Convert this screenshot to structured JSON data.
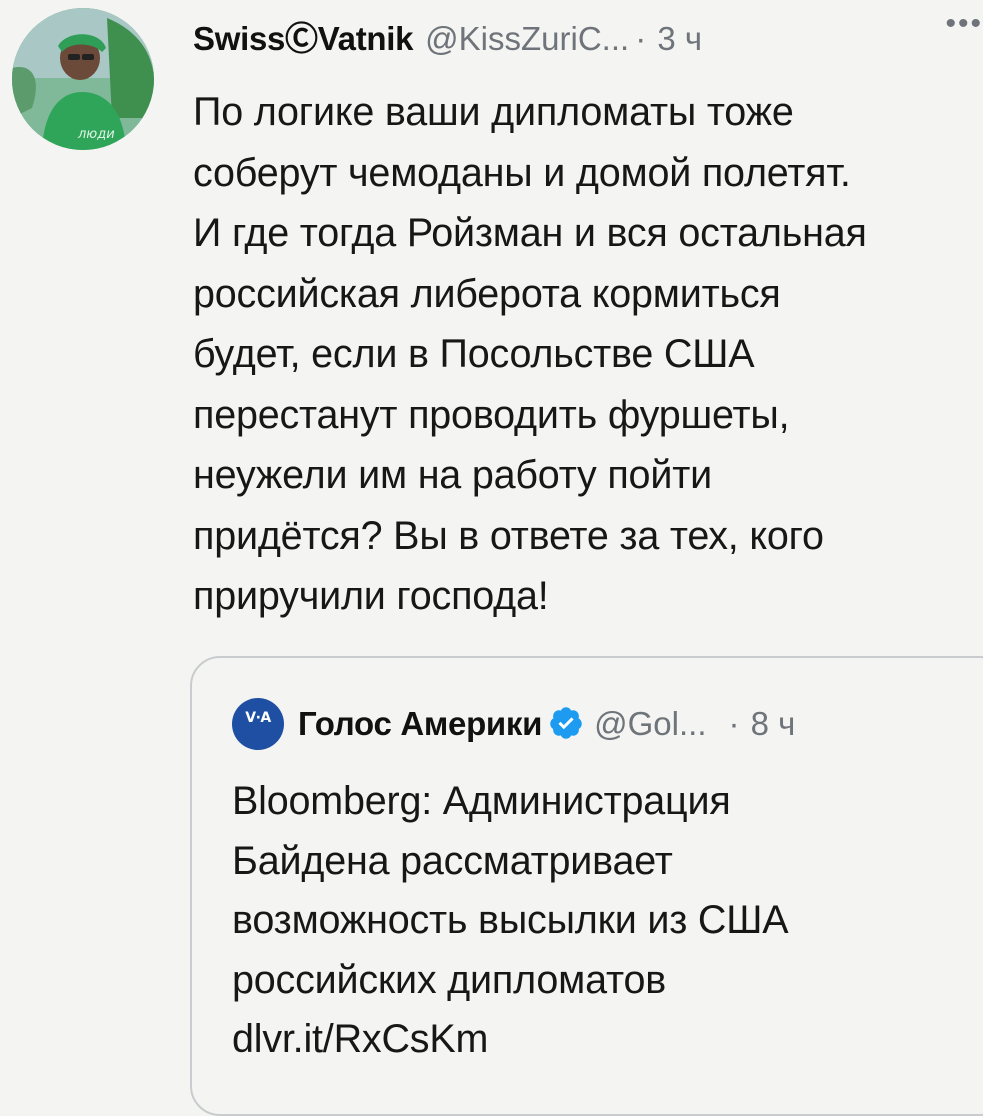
{
  "tweet": {
    "author": {
      "display_name": "SwissⒸVatnik",
      "handle": "@KissZuriC...",
      "separator": "·",
      "time": "3 ч"
    },
    "more_menu": "•••",
    "text_lines": [
      "По логике ваши дипломаты тоже",
      "соберут чемоданы и домой полетят.",
      "И где тогда Ройзман и вся остальная",
      "российская либерота кормиться",
      "будет, если в Посольстве США",
      "перестанут проводить фуршеты,",
      "неужели им на работу пойти",
      "придётся? Вы в ответе за тех, кого",
      "приручили господа!"
    ]
  },
  "quoted_tweet": {
    "avatar_text": "V·A",
    "author": {
      "display_name": "Голос Америки",
      "handle": "@Gol...",
      "separator": "·",
      "time": "8 ч"
    },
    "text_lines": [
      "Bloomberg: Администрация",
      "Байдена рассматривает",
      "возможность высылки из США",
      "российских дипломатов",
      "dlvr.it/RxCsKm"
    ]
  },
  "colors": {
    "background": "#f4f4f2",
    "secondary_text": "#6e7479",
    "verified": "#1d9bf0",
    "voa_blue": "#1f4fa3",
    "avatar_green": "#4caf6a"
  },
  "icons": {
    "avatar": "user-avatar-photo",
    "more": "more-horizontal-icon",
    "voa_logo": "voa-logo-icon",
    "verified": "verified-badge-icon"
  }
}
